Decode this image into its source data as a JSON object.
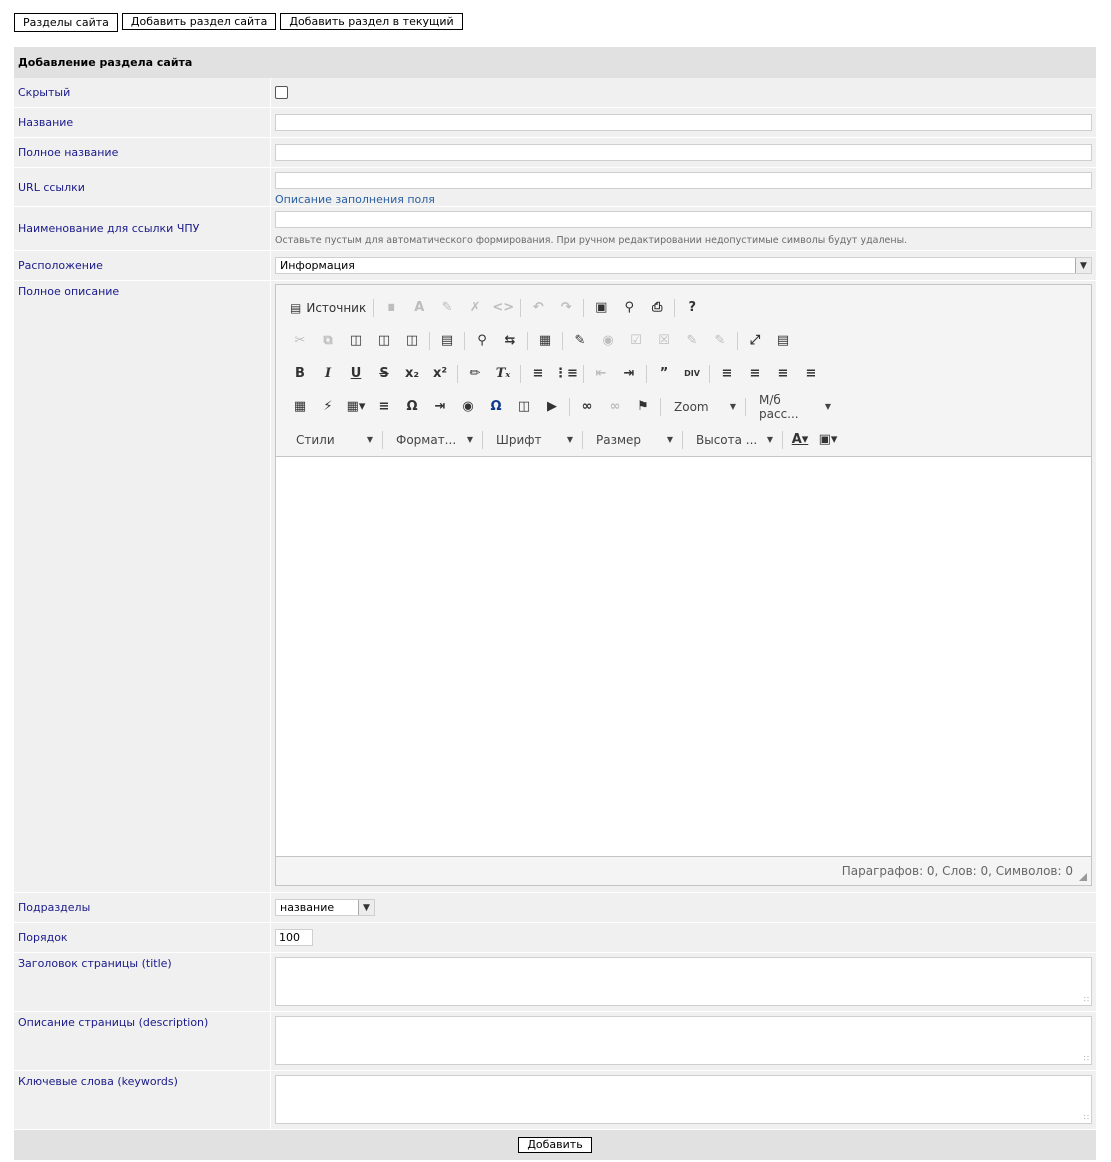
{
  "top_buttons": [
    "Разделы сайта",
    "Добавить раздел сайта",
    "Добавить раздел в текущий"
  ],
  "form": {
    "header": "Добавление раздела сайта",
    "hidden_label": "Скрытый",
    "name_label": "Название",
    "fullname_label": "Полное название",
    "url_label": "URL ссылки",
    "url_help_link": "Описание заполнения поля",
    "cpu_label": "Наименование для ссылки ЧПУ",
    "cpu_hint": "Оставьте пустым для автоматического формирования. При ручном редактировании недопустимые символы будут удалены.",
    "location_label": "Расположение",
    "location_value": "Информация",
    "description_label": "Полное описание",
    "subsections_label": "Подразделы",
    "subsections_value": "название",
    "order_label": "Порядок",
    "order_value": "100",
    "title_label": "Заголовок страницы (title)",
    "desc_label": "Описание страницы (description)",
    "keywords_label": "Ключевые слова (keywords)",
    "submit": "Добавить"
  },
  "editor": {
    "source_label": "Источник",
    "zoom": "Zoom",
    "mb": "М/б расс...",
    "styles": "Стили",
    "format": "Формат...",
    "font": "Шрифт",
    "size": "Размер",
    "height": "Высота ...",
    "status": "Параграфов: 0, Слов: 0, Символов: 0"
  }
}
